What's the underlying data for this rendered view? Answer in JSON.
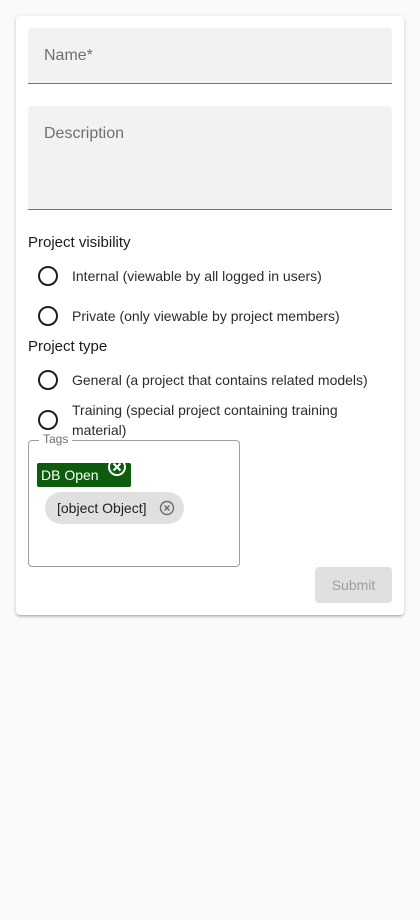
{
  "form": {
    "name_label": "Name*",
    "description_label": "Description",
    "visibility": {
      "title": "Project visibility",
      "options": [
        "Internal (viewable by all logged in users)",
        "Private (only viewable by project members)"
      ]
    },
    "type": {
      "title": "Project type",
      "options": [
        "General (a project that contains related models)",
        "Training (special project containing training material)"
      ]
    },
    "tags": {
      "legend": "Tags",
      "chips": [
        "DB Open",
        "[object Object]"
      ]
    },
    "submit_label": "Submit"
  },
  "colors": {
    "db_chip_bg": "#0d5c0d",
    "object_chip_bg": "#e0e0e0",
    "field_bg": "#f2f2f2",
    "submit_disabled_bg": "#e0e0e0"
  }
}
